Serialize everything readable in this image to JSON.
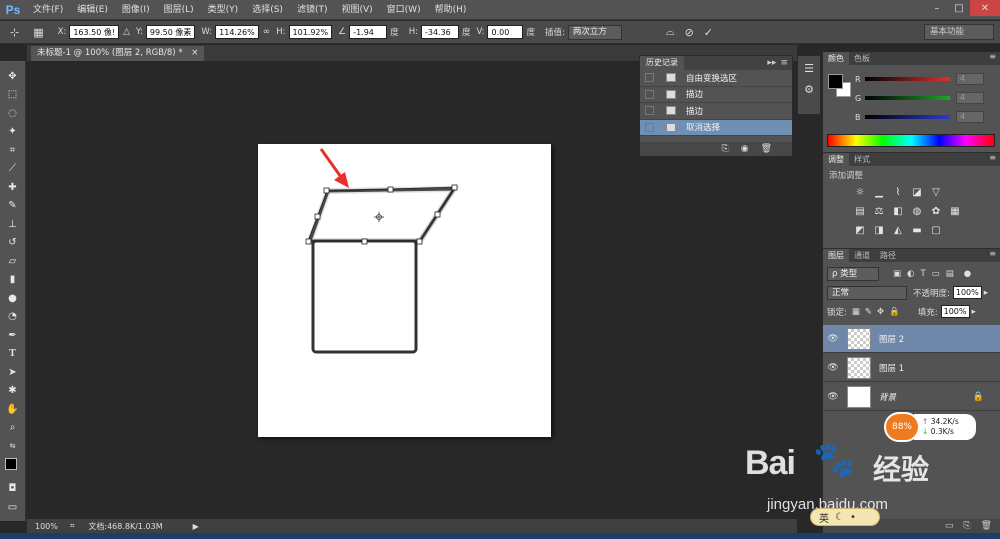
{
  "app": {
    "logo": "Ps"
  },
  "menu": [
    "文件(F)",
    "编辑(E)",
    "图像(I)",
    "图层(L)",
    "类型(Y)",
    "选择(S)",
    "滤镜(T)",
    "视图(V)",
    "窗口(W)",
    "帮助(H)"
  ],
  "window_controls": {
    "minimize": "–",
    "maximize": "□",
    "close": "✕"
  },
  "options": {
    "x_label": "X:",
    "x_value": "163.50 像!",
    "y_label": "Y:",
    "y_value": "99.50 像素",
    "w_label": "W:",
    "w_value": "114.26%",
    "h_label": "H:",
    "h_value": "101.92%",
    "angle_value": "-1.94",
    "angle_unit": "度",
    "hskew_label": "H:",
    "hskew_value": "-34.36",
    "hskew_unit": "度",
    "vskew_label": "V:",
    "vskew_value": "0.00",
    "vskew_unit": "度",
    "interp_label": "插值:",
    "interp_value": "两次立方",
    "workspace": "基本功能"
  },
  "document": {
    "tab_title": "未标题-1 @ 100% (图层 2, RGB/8) *",
    "tab_close": "×"
  },
  "status": {
    "zoom": "100%",
    "doc_info": "文档:468.8K/1.03M"
  },
  "history": {
    "tabs": [
      "历史记录"
    ],
    "items": [
      {
        "label": "自由变换选区",
        "selected": false
      },
      {
        "label": "描边",
        "selected": false
      },
      {
        "label": "描边",
        "selected": false
      },
      {
        "label": "取消选择",
        "selected": true
      }
    ]
  },
  "color_panel": {
    "tabs": [
      "颜色",
      "色板"
    ],
    "sliders": [
      {
        "label": "R",
        "value": "4",
        "color": "#e23030"
      },
      {
        "label": "G",
        "value": "4",
        "color": "#1fa32a"
      },
      {
        "label": "B",
        "value": "4",
        "color": "#2a3ad6"
      }
    ]
  },
  "adjust_panel": {
    "tabs": [
      "调整",
      "样式"
    ],
    "title": "添加调整"
  },
  "layers_panel": {
    "tabs": [
      "图层",
      "通道",
      "路径"
    ],
    "filter": "ρ 类型",
    "blend_mode": "正常",
    "opacity_label": "不透明度:",
    "opacity_value": "100%",
    "lock_label": "锁定:",
    "fill_label": "填充:",
    "fill_value": "100%",
    "layers": [
      {
        "name": "图层 2",
        "selected": true
      },
      {
        "name": "图层 1",
        "selected": false
      },
      {
        "name": "背景",
        "selected": false
      }
    ]
  },
  "network": {
    "percent": "88%",
    "up": "34.2K/s",
    "down": "0.3K/s"
  },
  "watermark": {
    "brand": "Bai",
    "brand_cn": "经验",
    "url": "jingyan.baidu.com"
  },
  "ime": {
    "label": "英"
  },
  "colors": {
    "accent_selection": "#6f8fb3",
    "arrow": "#e8302a"
  }
}
